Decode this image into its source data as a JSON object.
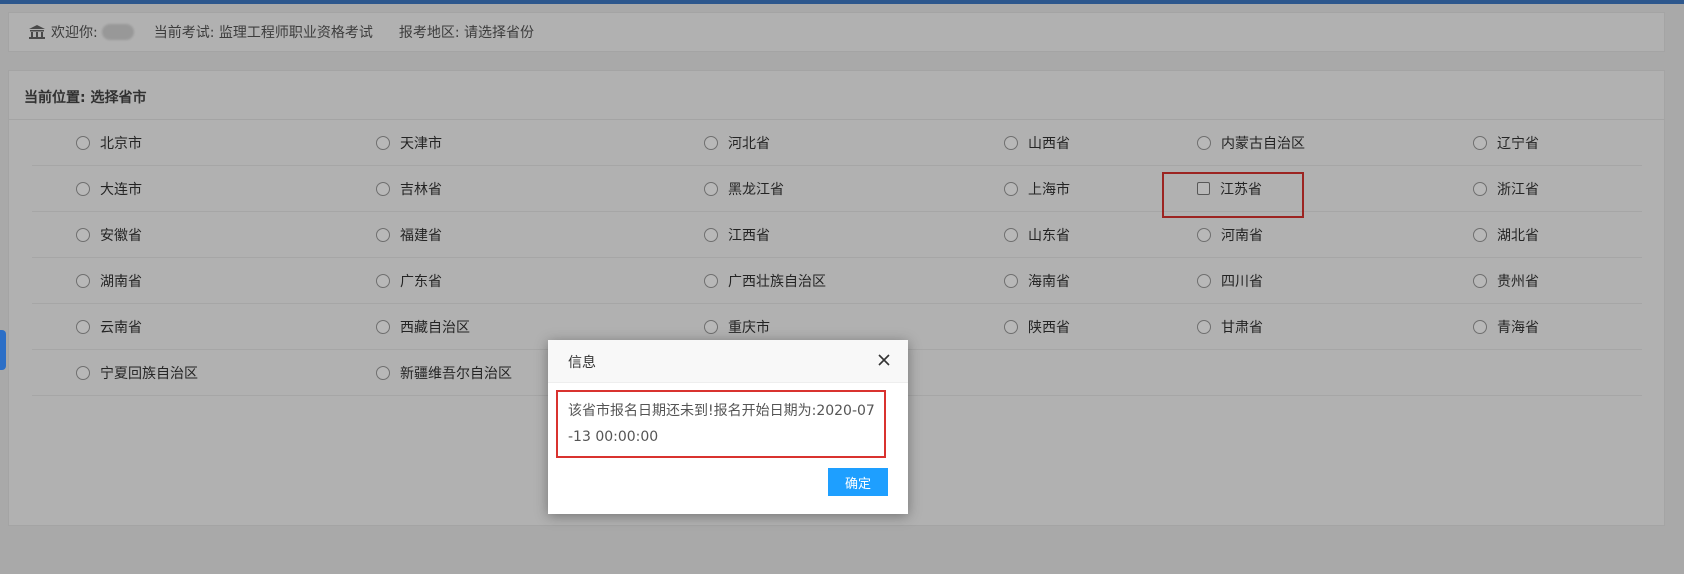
{
  "header": {
    "greeting": "欢迎你:",
    "exam": "当前考试: 监理工程师职业资格考试",
    "region": "报考地区: 请选择省份"
  },
  "breadcrumb": "当前位置: 选择省市",
  "provinces": [
    [
      "北京市",
      "天津市",
      "河北省",
      "山西省",
      "内蒙古自治区",
      "辽宁省"
    ],
    [
      "大连市",
      "吉林省",
      "黑龙江省",
      "上海市",
      "江苏省",
      "浙江省"
    ],
    [
      "安徽省",
      "福建省",
      "江西省",
      "山东省",
      "河南省",
      "湖北省"
    ],
    [
      "湖南省",
      "广东省",
      "广西壮族自治区",
      "海南省",
      "四川省",
      "贵州省"
    ],
    [
      "云南省",
      "西藏自治区",
      "重庆市",
      "陕西省",
      "甘肃省",
      "青海省"
    ],
    [
      "宁夏回族自治区",
      "新疆维吾尔自治区"
    ]
  ],
  "dialog": {
    "title": "信息",
    "message": "该省市报名日期还未到!报名开始日期为:2020-07-13 00:00:00",
    "ok_label": "确定"
  },
  "colors": {
    "accent": "#1e9fff",
    "highlight": "#d9322f",
    "topbar": "#3f79c4"
  }
}
